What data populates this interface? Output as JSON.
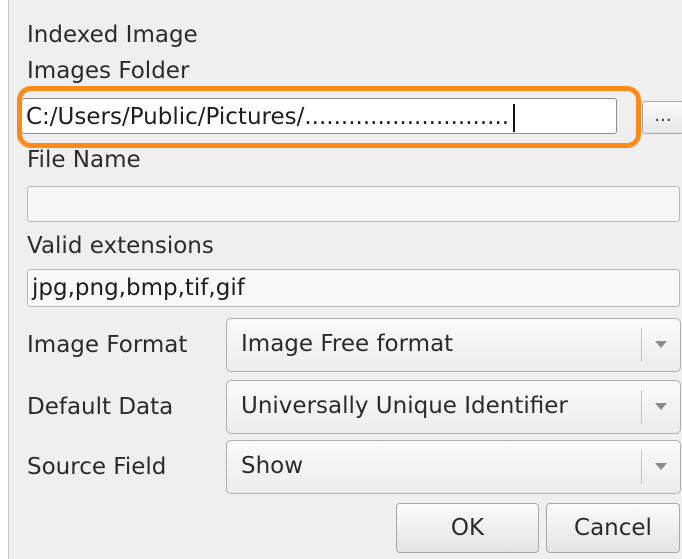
{
  "indexed_image": {
    "label": "Indexed Image"
  },
  "images_folder": {
    "label": "Images Folder",
    "value": "C:/Users/Public/Pictures/............................",
    "browse_label": "..."
  },
  "file_name": {
    "label": "File Name",
    "value": ""
  },
  "valid_extensions": {
    "label": "Valid extensions",
    "value": "jpg,png,bmp,tif,gif"
  },
  "image_format": {
    "label": "Image Format",
    "value": "Image Free format"
  },
  "default_data": {
    "label": "Default Data",
    "value": "Universally Unique Identifier"
  },
  "source_field": {
    "label": "Source Field",
    "value": "Show"
  },
  "buttons": {
    "ok": "OK",
    "cancel": "Cancel"
  },
  "colors": {
    "highlight": "#ff8a1c"
  },
  "icons": {
    "combo_arrow": "chevron-down-icon"
  }
}
